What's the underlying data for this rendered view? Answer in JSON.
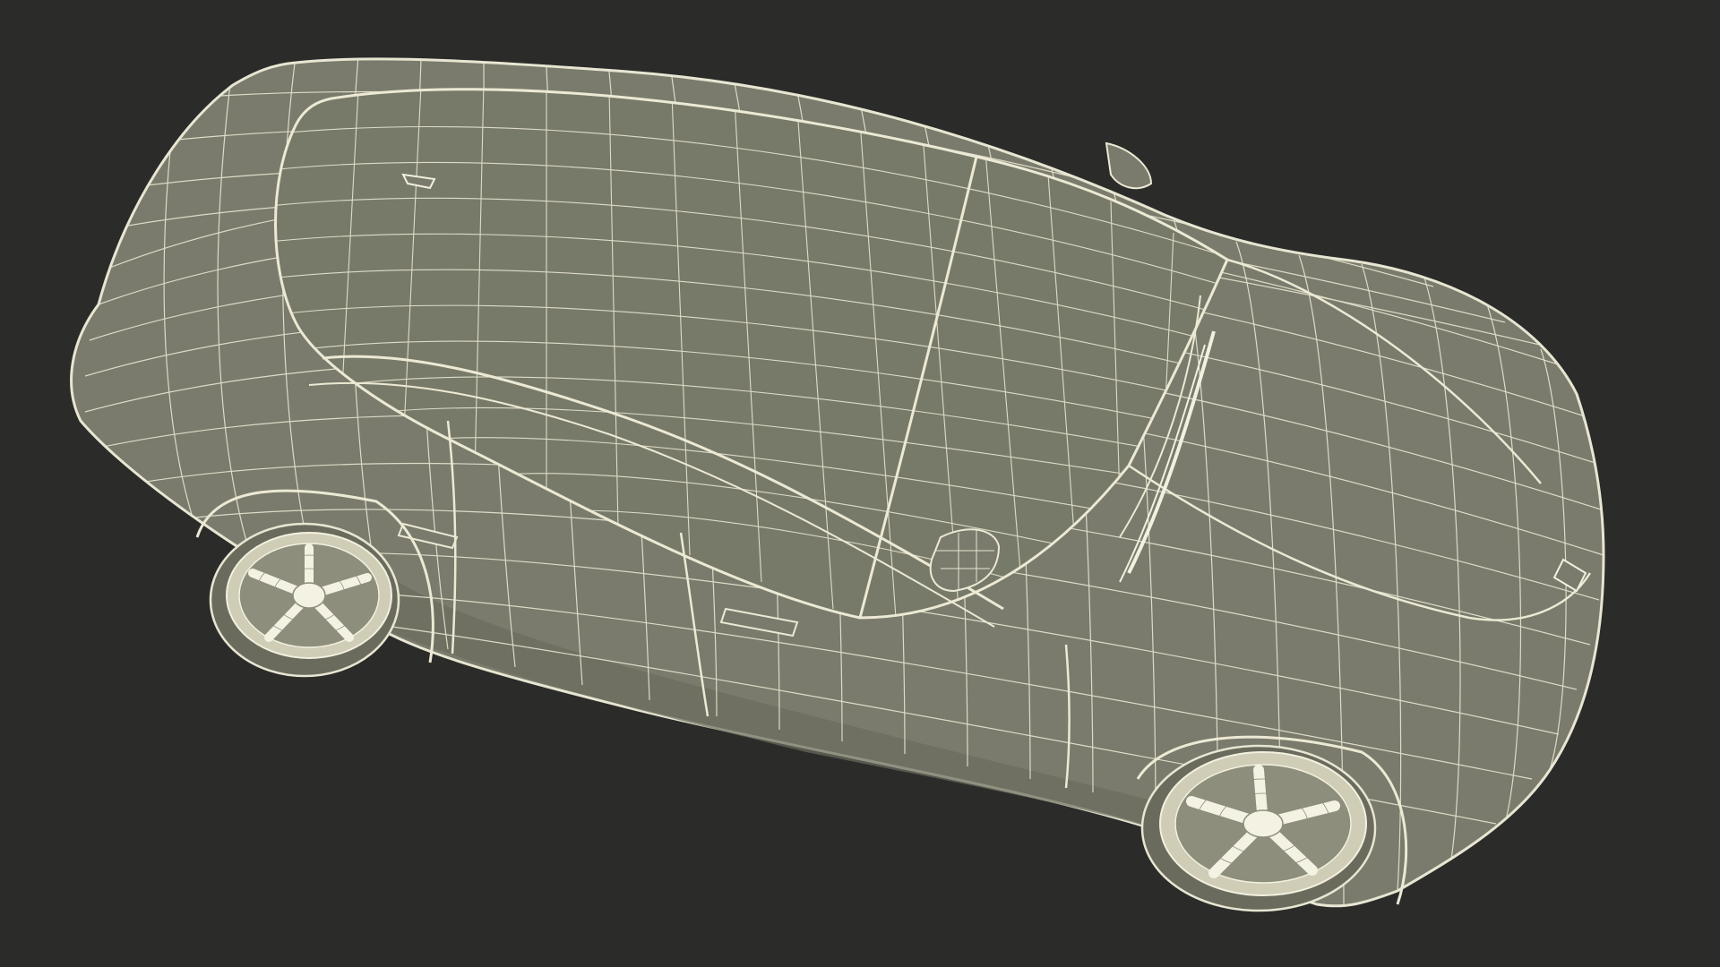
{
  "scene": {
    "background_color": "#2b2b2a",
    "body_color": "#7a7b6c",
    "body_shadow_color": "#5f6054",
    "wire_color": "#e8e6d2",
    "rim_color": "#cfcdb6",
    "icons": {
      "car_model": "car-wireframe-icon"
    }
  }
}
